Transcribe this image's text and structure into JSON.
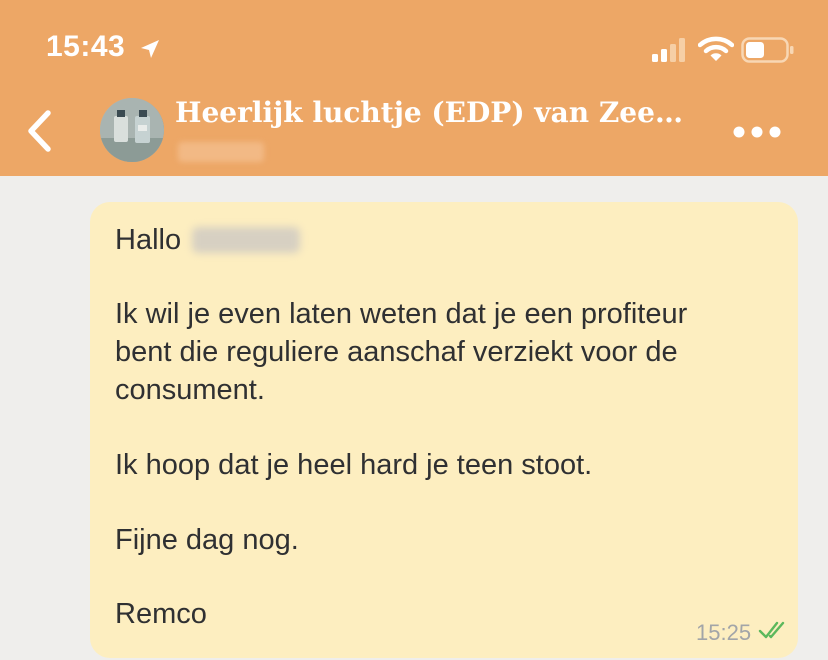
{
  "status_bar": {
    "time": "15:43"
  },
  "chat_header": {
    "title": "Heerlijk luchtje (EDP) van Zeeman...",
    "back_icon": "chevron-left-icon",
    "more_icon": "ellipsis-icon"
  },
  "message": {
    "greeting": "Hallo",
    "lines": [
      "Ik wil je even laten weten dat je een profiteur",
      "bent die reguliere aanschaf verziekt voor de",
      "consument.",
      "Ik hoop dat je heel hard je teen stoot.",
      "Fijne dag nog.",
      "Remco"
    ],
    "time": "15:25",
    "status": "read"
  },
  "colors": {
    "header_bg": "#eda766",
    "chat_bg": "#efeeec",
    "bubble_bg": "#fdeec0",
    "text": "#2f3032",
    "timestamp": "#a2a5a8",
    "read_check": "#5cb85c"
  }
}
